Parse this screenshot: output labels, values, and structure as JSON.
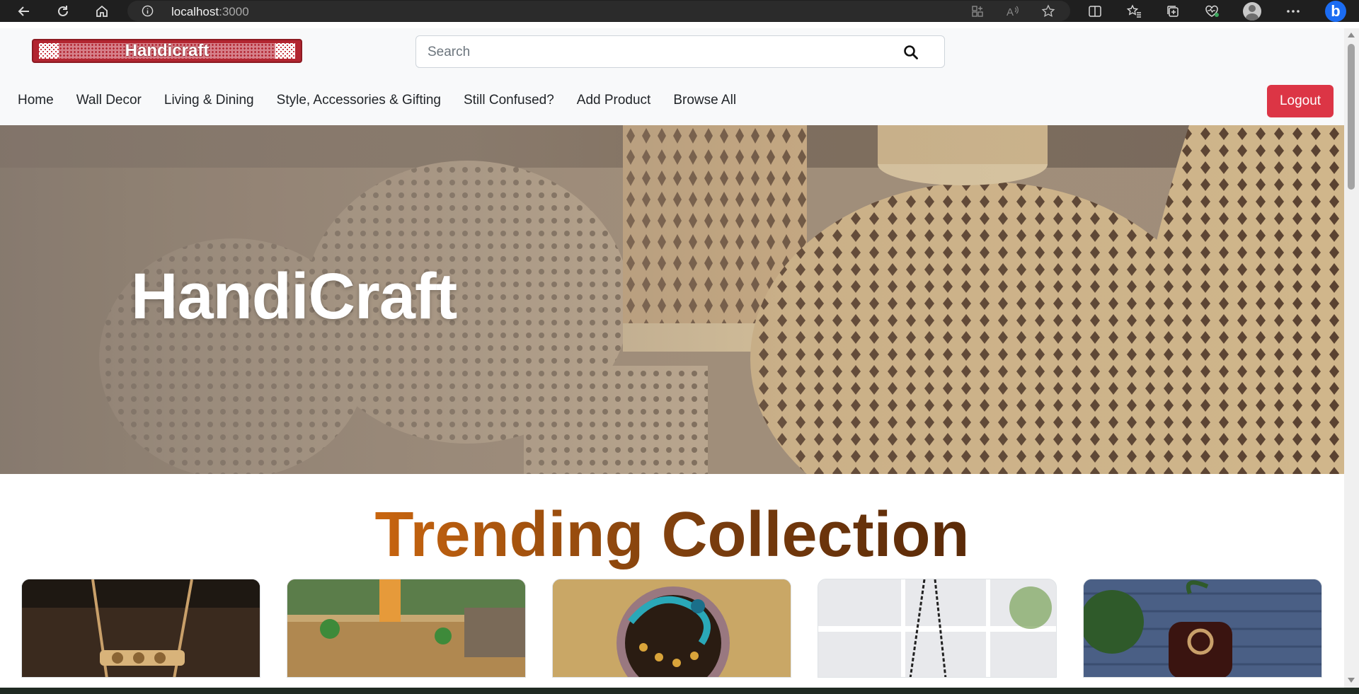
{
  "browser": {
    "url_host": "localhost",
    "url_port": ":3000",
    "icons": [
      "back-icon",
      "reload-icon",
      "home-icon",
      "site-info-icon",
      "app-available-icon",
      "read-aloud-icon",
      "favorite-star-icon",
      "split-screen-icon",
      "favorites-icon",
      "collections-icon",
      "browser-essentials-icon",
      "profile-icon",
      "more-icon",
      "bing-copilot-icon"
    ]
  },
  "navbar": {
    "logo_text": "Handicraft",
    "search_placeholder": "Search",
    "links": [
      {
        "label": "Home"
      },
      {
        "label": "Wall Decor"
      },
      {
        "label": "Living & Dining"
      },
      {
        "label": "Style, Accessories & Gifting"
      },
      {
        "label": "Still Confused?"
      },
      {
        "label": "Add Product"
      },
      {
        "label": "Browse All"
      }
    ],
    "logout_label": "Logout"
  },
  "hero": {
    "title": "HandiCraft"
  },
  "trending": {
    "title": "Trending Collection",
    "cards": [
      {
        "name": "product-card-1",
        "bg": "#3a2a1e"
      },
      {
        "name": "product-card-2",
        "bg": "#8a6a3a"
      },
      {
        "name": "product-card-3",
        "bg": "#a88a50"
      },
      {
        "name": "product-card-4",
        "bg": "#e9eaec"
      },
      {
        "name": "product-card-5",
        "bg": "#41557a"
      }
    ]
  },
  "colors": {
    "logout": "#dc3545",
    "logo": "#b22530",
    "navbar_bg": "#f8f9fa",
    "trend_gradient_start": "#c8650f",
    "trend_gradient_end": "#5a2a08"
  }
}
